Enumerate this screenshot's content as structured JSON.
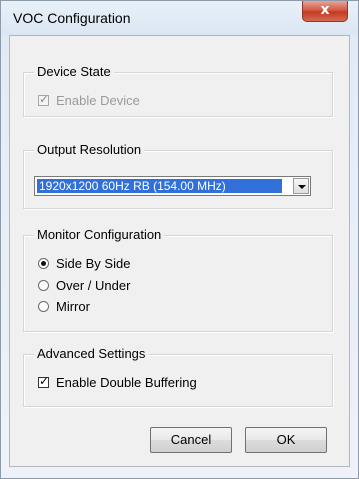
{
  "window": {
    "title": "VOC Configuration",
    "close_label": "x"
  },
  "device_state": {
    "legend": "Device State",
    "enable_device": {
      "label": "Enable Device",
      "checked": true,
      "disabled": true
    }
  },
  "output_resolution": {
    "legend": "Output Resolution",
    "selected": "1920x1200 60Hz RB   (154.00 MHz)"
  },
  "monitor_configuration": {
    "legend": "Monitor Configuration",
    "options": [
      {
        "label": "Side By Side",
        "checked": true
      },
      {
        "label": "Over / Under",
        "checked": false
      },
      {
        "label": "Mirror",
        "checked": false
      }
    ]
  },
  "advanced_settings": {
    "legend": "Advanced Settings",
    "double_buffering": {
      "label": "Enable Double Buffering",
      "checked": true
    }
  },
  "buttons": {
    "cancel": "Cancel",
    "ok": "OK"
  },
  "check_glyph": "✓",
  "colors": {
    "selection": "#3070d8",
    "close_button": "#c9452d"
  }
}
